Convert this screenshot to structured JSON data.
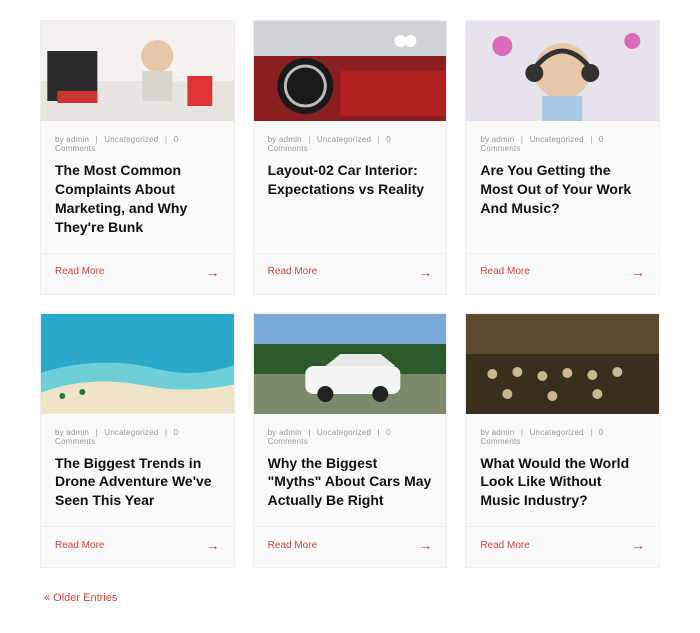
{
  "meta": {
    "by_prefix": "by",
    "author": "admin",
    "category": "Uncategorized",
    "comments": "0 Comments"
  },
  "read_more_label": "Read More",
  "older_entries_label": "« Older Entries",
  "posts": [
    {
      "title": "The Most Common Complaints About Marketing, and Why They're Bunk",
      "img": "woman-desk"
    },
    {
      "title": "Layout-02 Car Interior: Expectations vs Reality",
      "img": "car-interior"
    },
    {
      "title": "Are You Getting the Most Out of Your Work And Music?",
      "img": "headphones-woman"
    },
    {
      "title": "The Biggest Trends in Drone Adventure We've Seen This Year",
      "img": "beach-aerial"
    },
    {
      "title": "Why the Biggest \"Myths\" About Cars May Actually Be Right",
      "img": "white-car"
    },
    {
      "title": "What Would the World Look Like Without Music Industry?",
      "img": "orchestra"
    }
  ]
}
